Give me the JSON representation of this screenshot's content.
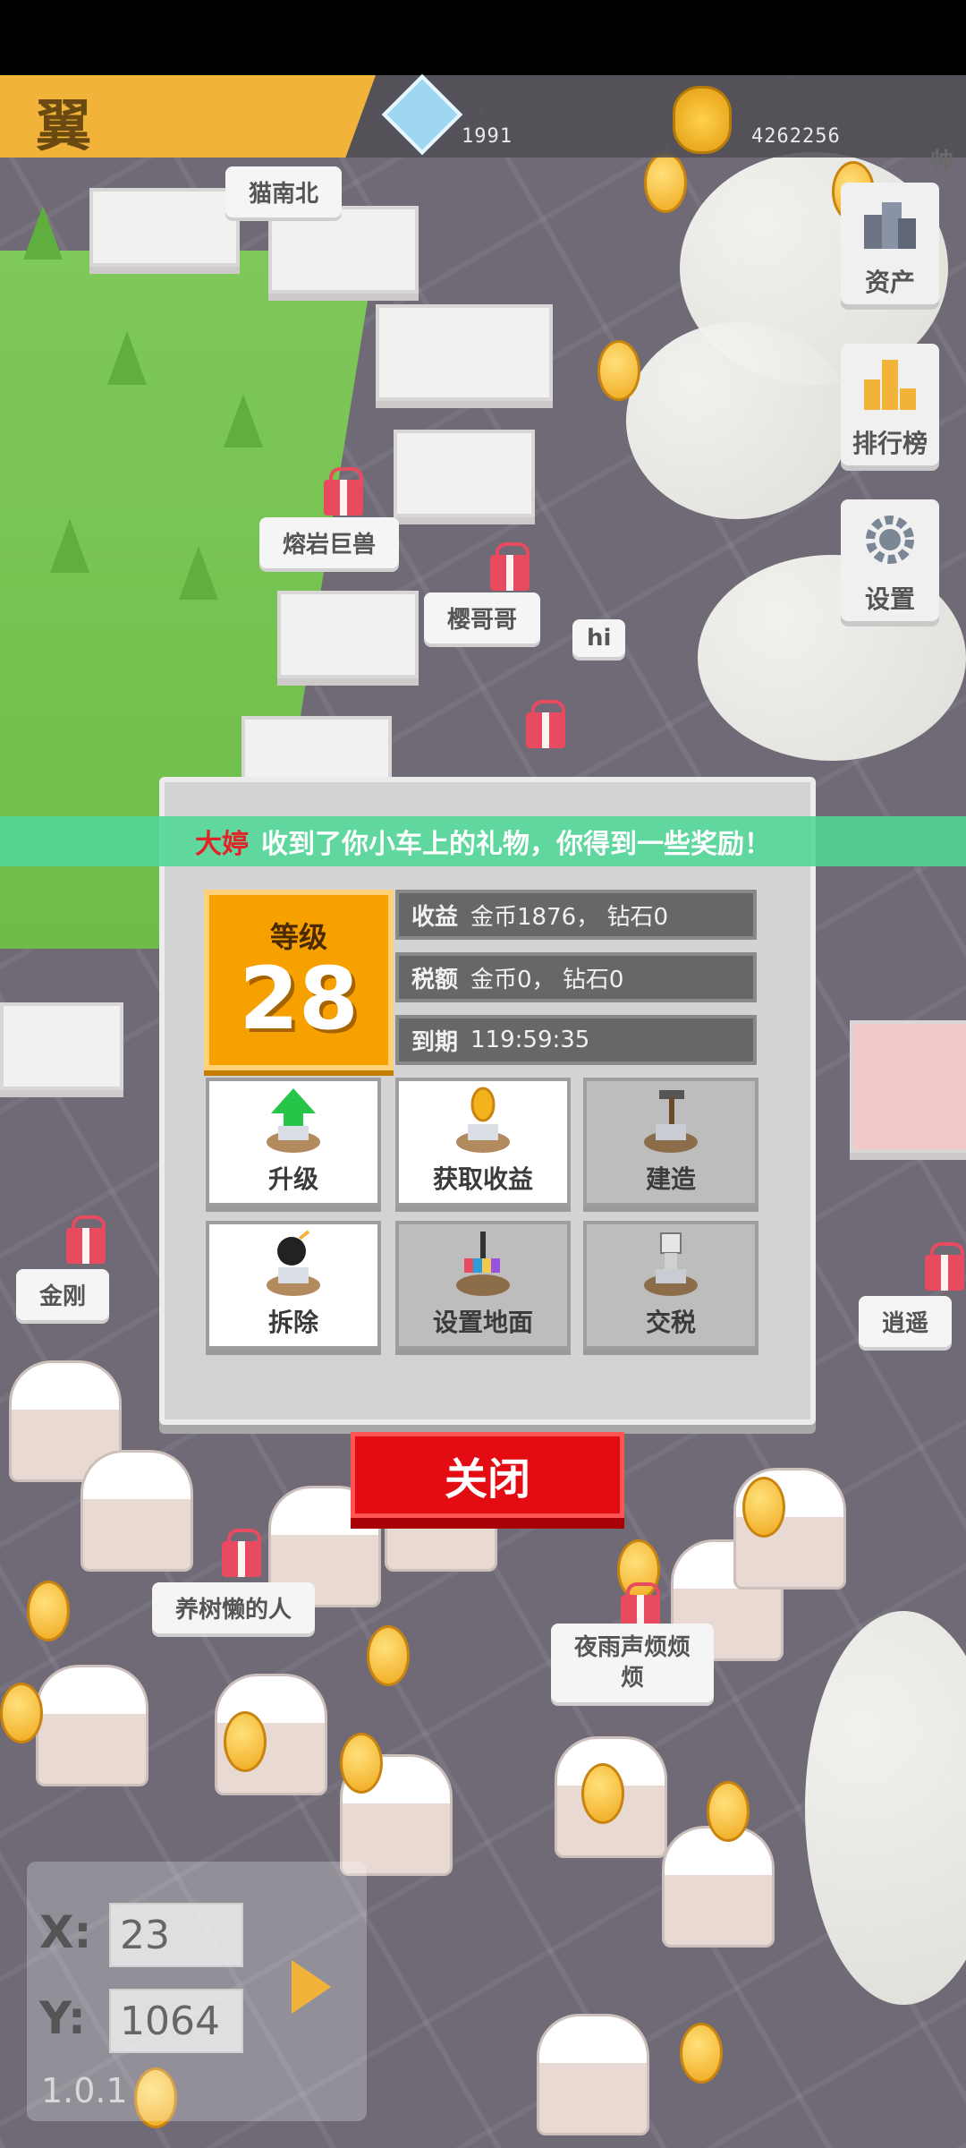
{
  "header": {
    "logo_char": "翼",
    "diamonds": "1991",
    "coins": "4262256",
    "edge_label": "帅"
  },
  "side_menu": [
    {
      "label": "资产",
      "icon": "assets-icon"
    },
    {
      "label": "排行榜",
      "icon": "leaderboard-icon"
    },
    {
      "label": "设置",
      "icon": "gear-icon"
    }
  ],
  "map_labels": {
    "player1": "猫南北",
    "player2": "熔岩巨兽",
    "player3": "樱哥哥",
    "player3_chat": "hi",
    "player4": "金刚",
    "player5": "逍遥",
    "player6": "养树懒的人",
    "player7_line1": "夜雨声烦烦",
    "player7_line2": "烦"
  },
  "notice": {
    "who": "大婷",
    "message": "收到了你小车上的礼物，你得到一些奖励！"
  },
  "dialog": {
    "title": "",
    "level_label": "等级",
    "level_value": "28",
    "income": {
      "label": "收益",
      "value": "金币1876，  钻石0"
    },
    "tax": {
      "label": "税额",
      "value": "金币0，  钻石0"
    },
    "expiry": {
      "label": "到期",
      "value": "119:59:35"
    },
    "actions": [
      {
        "label": "升级",
        "icon": "upgrade-arrow-icon",
        "enabled": true
      },
      {
        "label": "获取收益",
        "icon": "coin-collect-icon",
        "enabled": true
      },
      {
        "label": "建造",
        "icon": "hammer-build-icon",
        "enabled": false
      },
      {
        "label": "拆除",
        "icon": "bomb-demolish-icon",
        "enabled": true
      },
      {
        "label": "设置地面",
        "icon": "paint-ground-icon",
        "enabled": false
      },
      {
        "label": "交税",
        "icon": "tax-skull-icon",
        "enabled": false
      }
    ],
    "close_label": "关闭"
  },
  "coords": {
    "x_label": "X:",
    "y_label": "Y:",
    "x_value": "23",
    "y_value": "1064"
  },
  "version": "1.0.1",
  "colors": {
    "accent_orange": "#f7a100",
    "header_gold": "#f2b33a",
    "close_red": "#e30c13",
    "notice_green": "#50d796"
  }
}
